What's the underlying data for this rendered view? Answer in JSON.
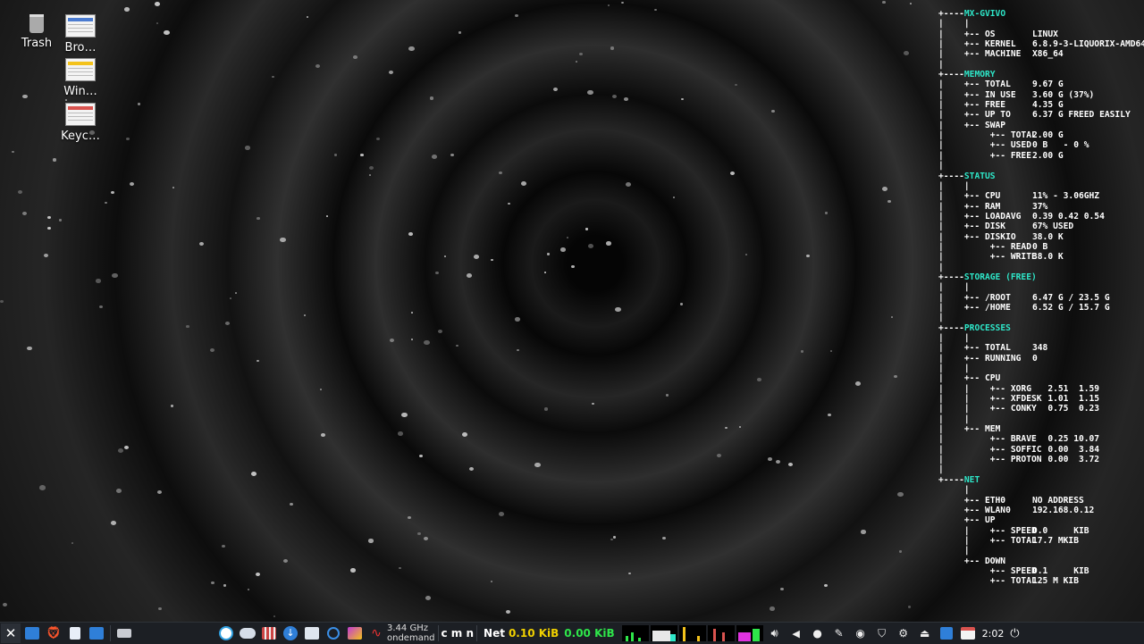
{
  "desktop": {
    "icons": [
      {
        "label": "Trash",
        "kind": "trash"
      },
      {
        "label": "Bro…",
        "kind": "doc-blue"
      },
      {
        "label": "Win…",
        "kind": "doc-yellow"
      },
      {
        "label": "Keyc…",
        "kind": "doc-red"
      }
    ]
  },
  "conky": {
    "lines": [
      {
        "pre": "+----",
        "key": "MX-GVIVO",
        "val": "",
        "head": true
      },
      {
        "pre": "|    |",
        "key": "",
        "val": ""
      },
      {
        "pre": "|    +-- ",
        "key": "OS",
        "val": "LINUX"
      },
      {
        "pre": "|    +-- ",
        "key": "KERNEL",
        "val": "6.8.9-3-LIQUORIX-AMD64"
      },
      {
        "pre": "|    +-- ",
        "key": "MACHINE",
        "val": "X86_64"
      },
      {
        "pre": "|",
        "key": "",
        "val": ""
      },
      {
        "pre": "+----",
        "key": "MEMORY",
        "val": "",
        "head": true
      },
      {
        "pre": "|    +-- ",
        "key": "TOTAL",
        "val": "9.67 G"
      },
      {
        "pre": "|    +-- ",
        "key": "IN USE",
        "val": "3.60 G (37%)"
      },
      {
        "pre": "|    +-- ",
        "key": "FREE",
        "val": "4.35 G"
      },
      {
        "pre": "|    +-- ",
        "key": "UP TO",
        "val": "6.37 G FREED EASILY"
      },
      {
        "pre": "|    +-- ",
        "key": "SWAP",
        "val": ""
      },
      {
        "pre": "|         +-- ",
        "key": "TOTAL",
        "val": "2.00 G"
      },
      {
        "pre": "|         +-- ",
        "key": "USED",
        "val": "0 B   - 0 %"
      },
      {
        "pre": "|         +-- ",
        "key": "FREE",
        "val": "2.00 G"
      },
      {
        "pre": "|",
        "key": "",
        "val": ""
      },
      {
        "pre": "+----",
        "key": "STATUS",
        "val": "",
        "head": true
      },
      {
        "pre": "|    |",
        "key": "",
        "val": ""
      },
      {
        "pre": "|    +-- ",
        "key": "CPU",
        "val": "11% - 3.06GHZ"
      },
      {
        "pre": "|    +-- ",
        "key": "RAM",
        "val": "37%"
      },
      {
        "pre": "|    +-- ",
        "key": "LOADAVG",
        "val": "0.39 0.42 0.54"
      },
      {
        "pre": "|    +-- ",
        "key": "DISK",
        "val": "67% USED"
      },
      {
        "pre": "|    +-- ",
        "key": "DISKIO",
        "val": "38.0 K"
      },
      {
        "pre": "|         +-- ",
        "key": "READ",
        "val": "0 B"
      },
      {
        "pre": "|         +-- ",
        "key": "WRITE",
        "val": "38.0 K"
      },
      {
        "pre": "|",
        "key": "",
        "val": ""
      },
      {
        "pre": "+----",
        "key": "STORAGE (FREE)",
        "val": "",
        "head": true
      },
      {
        "pre": "|    |",
        "key": "",
        "val": ""
      },
      {
        "pre": "|    +-- ",
        "key": "/ROOT",
        "val": "6.47 G / 23.5 G"
      },
      {
        "pre": "|    +-- ",
        "key": "/HOME",
        "val": "6.52 G / 15.7 G"
      },
      {
        "pre": "|",
        "key": "",
        "val": ""
      },
      {
        "pre": "+----",
        "key": "PROCESSES",
        "val": "",
        "head": true
      },
      {
        "pre": "|    |",
        "key": "",
        "val": ""
      },
      {
        "pre": "|    +-- ",
        "key": "TOTAL",
        "val": "348"
      },
      {
        "pre": "|    +-- ",
        "key": "RUNNING",
        "val": "0"
      },
      {
        "pre": "|    |",
        "key": "",
        "val": ""
      },
      {
        "pre": "|    +-- ",
        "key": "CPU",
        "val": ""
      },
      {
        "pre": "|    |    +-- ",
        "key": "XORG",
        "val": "   2.51  1.59"
      },
      {
        "pre": "|    |    +-- ",
        "key": "XFDESK",
        "val": "   1.01  1.15"
      },
      {
        "pre": "|    |    +-- ",
        "key": "CONKY",
        "val": "   0.75  0.23"
      },
      {
        "pre": "|    |",
        "key": "",
        "val": ""
      },
      {
        "pre": "|    +-- ",
        "key": "MEM",
        "val": ""
      },
      {
        "pre": "|         +-- ",
        "key": "BRAVE",
        "val": "   0.25 10.07"
      },
      {
        "pre": "|         +-- ",
        "key": "SOFFIC",
        "val": "   0.00  3.84"
      },
      {
        "pre": "|         +-- ",
        "key": "PROTON",
        "val": "   0.00  3.72"
      },
      {
        "pre": "|",
        "key": "",
        "val": ""
      },
      {
        "pre": "+----",
        "key": "NET",
        "val": "",
        "head": true
      },
      {
        "pre": "     |",
        "key": "",
        "val": ""
      },
      {
        "pre": "     +-- ",
        "key": "ETH0",
        "val": "NO ADDRESS"
      },
      {
        "pre": "     +-- ",
        "key": "WLAN0",
        "val": "192.168.0.12"
      },
      {
        "pre": "     +-- ",
        "key": "UP",
        "val": ""
      },
      {
        "pre": "     |    +-- ",
        "key": "SPEED",
        "val": "0.0     KIB"
      },
      {
        "pre": "     |    +-- ",
        "key": "TOTAL",
        "val": "17.7 MKIB"
      },
      {
        "pre": "     |",
        "key": "",
        "val": ""
      },
      {
        "pre": "     +-- ",
        "key": "DOWN",
        "val": ""
      },
      {
        "pre": "          +-- ",
        "key": "SPEED",
        "val": "0.1     KIB"
      },
      {
        "pre": "          +-- ",
        "key": "TOTAL",
        "val": "125 M KIB"
      }
    ]
  },
  "taskbar": {
    "cpu_freq": "3.44 GHz",
    "governor": "ondemand",
    "cmn": "c m n",
    "net_label": "Net",
    "net_up": "0.10 KiB",
    "net_down": "0.00 KiB",
    "clock": "2:02"
  }
}
